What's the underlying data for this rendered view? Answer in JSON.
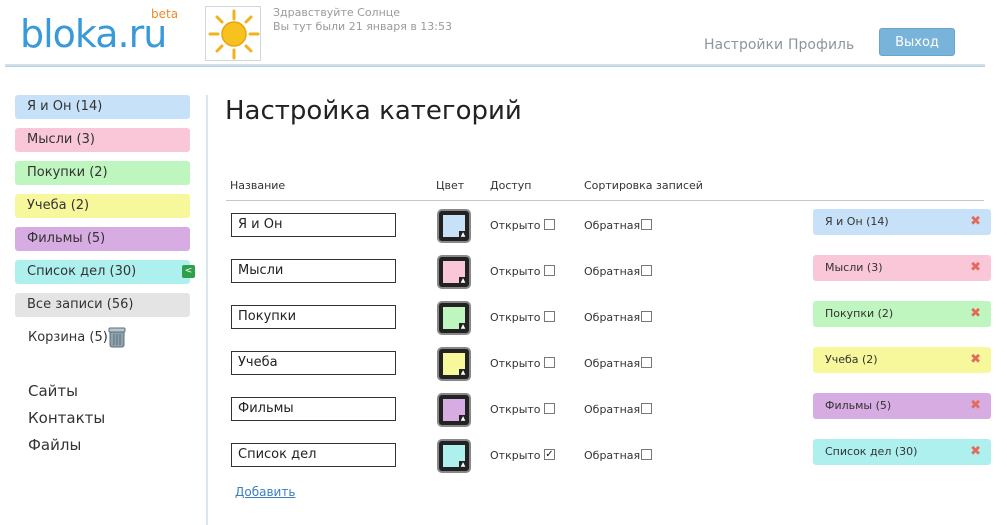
{
  "header": {
    "logo": "bloka.ru",
    "beta": "beta",
    "greeting": "Здравствуйте Солнце",
    "last_visit": "Вы тут были 21 января в 13:53",
    "settings_link": "Настройки",
    "profile_link": "Профиль",
    "logout_button": "Выход"
  },
  "sidebar": {
    "categories": [
      {
        "label": "Я и Он (14)",
        "color": "#c7e1f8"
      },
      {
        "label": "Мысли (3)",
        "color": "#f9c7d8"
      },
      {
        "label": "Покупки (2)",
        "color": "#bff5bf"
      },
      {
        "label": "Учеба (2)",
        "color": "#f7f79c"
      },
      {
        "label": "Фильмы (5)",
        "color": "#d7ace2"
      },
      {
        "label": "Список дел (30)",
        "color": "#aef0ee"
      },
      {
        "label": "Все записи (56)",
        "color": "#e4e4e4"
      }
    ],
    "trash": "Корзина (5)",
    "links": [
      "Сайты",
      "Контакты",
      "Файлы"
    ]
  },
  "main": {
    "title": "Настройка категорий",
    "columns": {
      "name": "Название",
      "color": "Цвет",
      "access": "Доступ",
      "sort": "Сортировка записей"
    },
    "rows": [
      {
        "name": "Я и Он",
        "color": "#c7e1f8",
        "access_label": "Открыто",
        "access_checked": false,
        "sort_label": "Обратная",
        "sort_checked": false,
        "preview": "Я и Он (14)"
      },
      {
        "name": "Мысли",
        "color": "#f9c7d8",
        "access_label": "Открыто",
        "access_checked": false,
        "sort_label": "Обратная",
        "sort_checked": false,
        "preview": "Мысли (3)"
      },
      {
        "name": "Покупки",
        "color": "#bff5bf",
        "access_label": "Открыто",
        "access_checked": false,
        "sort_label": "Обратная",
        "sort_checked": false,
        "preview": "Покупки (2)"
      },
      {
        "name": "Учеба",
        "color": "#f7f79c",
        "access_label": "Открыто",
        "access_checked": false,
        "sort_label": "Обратная",
        "sort_checked": false,
        "preview": "Учеба (2)"
      },
      {
        "name": "Фильмы",
        "color": "#d7ace2",
        "access_label": "Открыто",
        "access_checked": false,
        "sort_label": "Обратная",
        "sort_checked": false,
        "preview": "Фильмы (5)"
      },
      {
        "name": "Список дел",
        "color": "#aef0ee",
        "access_label": "Открыто",
        "access_checked": true,
        "sort_label": "Обратная",
        "sort_checked": false,
        "preview": "Список дел (30)"
      }
    ],
    "add_link": "Добавить"
  }
}
